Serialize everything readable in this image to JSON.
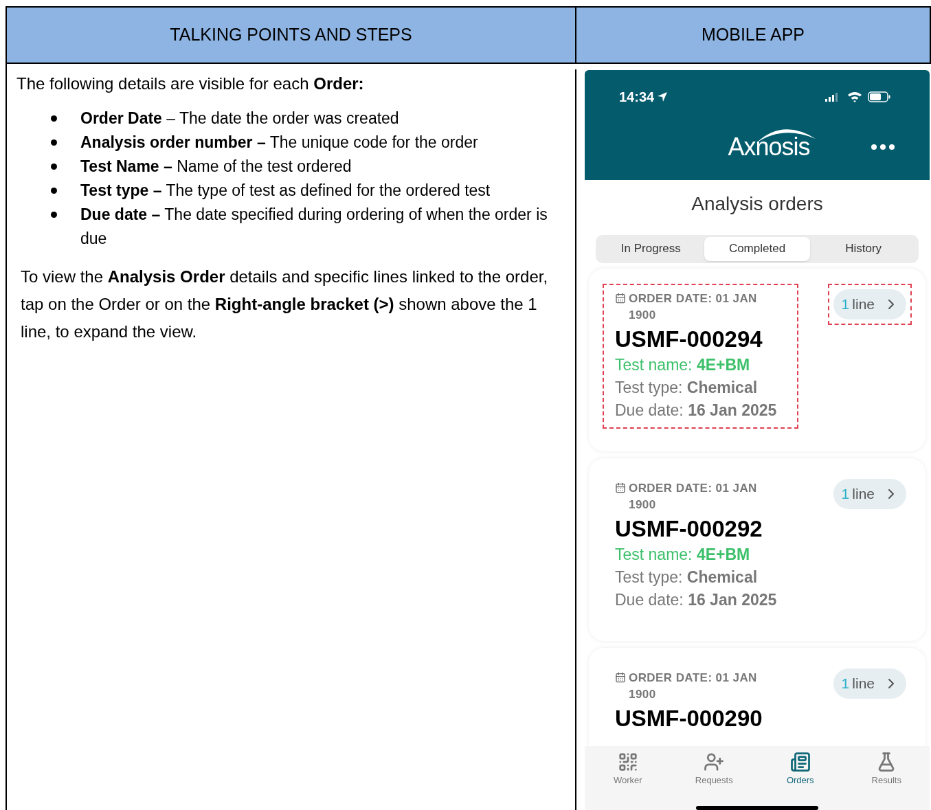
{
  "table": {
    "columns": [
      "TALKING POINTS AND STEPS",
      "MOBILE APP"
    ]
  },
  "talking_points": {
    "intro": "The following details are visible for each **Order:**",
    "bullets": [
      "**Order Date** – The date the order was created",
      "**Analysis order number –** The unique code for the order",
      "**Test Name –** Name of the test ordered",
      "**Test type –** The type of test as defined for the ordered test",
      "**Due date –** The date specified during ordering of when the order is due"
    ],
    "instruction": "To view the **Analysis Order** details and specific lines linked to the order, tap on the Order or on the **Right-angle bracket (>)** shown above the 1 line, to expand the view."
  },
  "mobile_app": {
    "status_bar": {
      "time": "14:34"
    },
    "header": {
      "logo": "Axnosis"
    },
    "title": "Analysis orders",
    "segments": [
      {
        "label": "In Progress",
        "selected": false
      },
      {
        "label": "Completed",
        "selected": true
      },
      {
        "label": "History",
        "selected": false
      }
    ],
    "orders": [
      {
        "order_date": "ORDER DATE: 01 JAN 1900",
        "number": "USMF-000294",
        "test_name_label": "Test name:",
        "test_name": "4E+BM",
        "test_type_label": "Test type:",
        "test_type": "Chemical",
        "due_date_label": "Due date:",
        "due_date": "16 Jan 2025",
        "line_count": "1",
        "line_label": "line",
        "highlighted": true
      },
      {
        "order_date": "ORDER DATE: 01 JAN 1900",
        "number": "USMF-000292",
        "test_name_label": "Test name:",
        "test_name": "4E+BM",
        "test_type_label": "Test type:",
        "test_type": "Chemical",
        "due_date_label": "Due date:",
        "due_date": "16 Jan 2025",
        "line_count": "1",
        "line_label": "line",
        "highlighted": false
      },
      {
        "order_date": "ORDER DATE: 01 JAN 1900",
        "number": "USMF-000290",
        "line_count": "1",
        "line_label": "line",
        "highlighted": false
      }
    ],
    "tab_bar": [
      {
        "kind": "worker",
        "label": "Worker",
        "selected": false
      },
      {
        "kind": "requests",
        "label": "Requests",
        "selected": false
      },
      {
        "kind": "orders",
        "label": "Orders",
        "selected": true
      },
      {
        "kind": "results",
        "label": "Results",
        "selected": false
      }
    ]
  }
}
